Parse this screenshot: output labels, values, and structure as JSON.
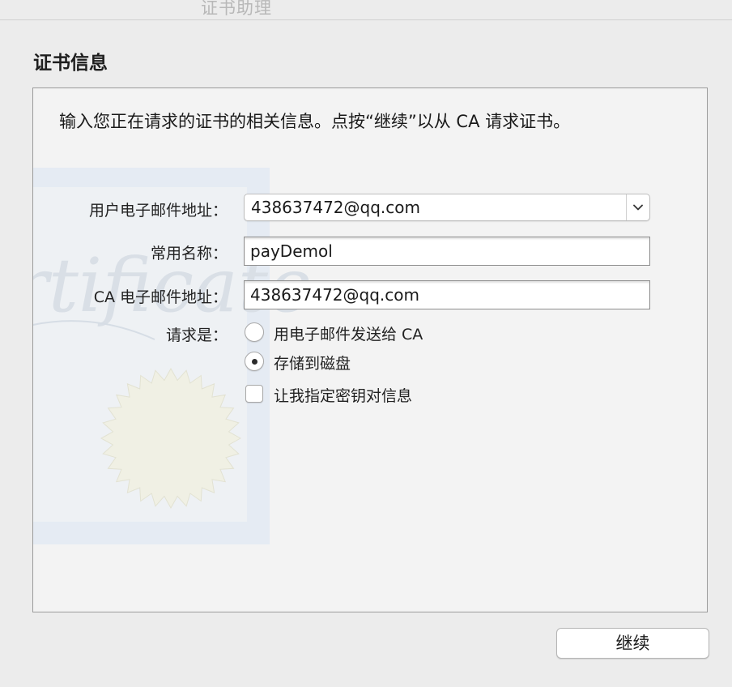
{
  "window": {
    "title": "证书助理"
  },
  "section_title": "证书信息",
  "intro_text": "输入您正在请求的证书的相关信息。点按“继续”以从 CA 请求证书。",
  "form": {
    "user_email": {
      "label": "用户电子邮件地址：",
      "value": "438637472@qq.com"
    },
    "common_name": {
      "label": "常用名称：",
      "value": "payDemol"
    },
    "ca_email": {
      "label": "CA 电子邮件地址：",
      "value": "438637472@qq.com"
    },
    "request": {
      "label": "请求是：",
      "options": [
        {
          "label": "用电子邮件发送给 CA",
          "selected": false
        },
        {
          "label": "存储到磁盘",
          "selected": true
        }
      ],
      "checkbox": {
        "label": "让我指定密钥对信息",
        "checked": false
      }
    }
  },
  "buttons": {
    "continue": "继续"
  },
  "watermark_text": "Certificate",
  "icons": {
    "combo_arrow": "chevron-down-icon",
    "watermark": "certificate-watermark",
    "seal": "certificate-seal"
  }
}
